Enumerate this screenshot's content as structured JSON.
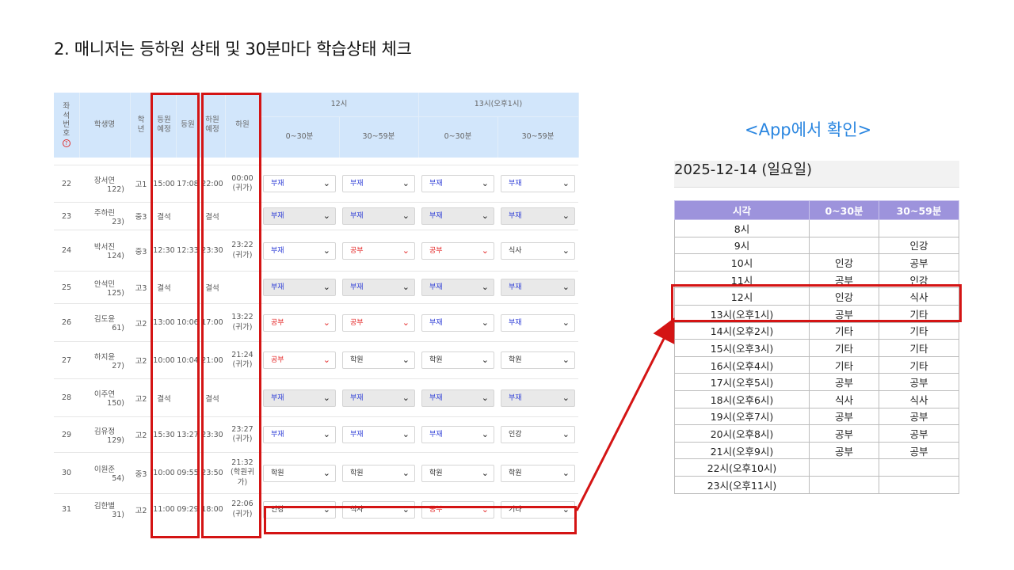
{
  "title": "2. 매니저는 등하원 상태 및 30분마다 학습상태 체크",
  "admin_table": {
    "headers": {
      "seat": "좌석번호",
      "name": "학생명",
      "grade": "학년",
      "arrive_planned": "등원예정",
      "arrive": "등원",
      "leave_planned": "하원예정",
      "leave": "하원",
      "hour12": "12시",
      "hour13": "13시(오후1시)",
      "slot1": "0~30분",
      "slot2": "30~59분"
    },
    "rows": [
      {
        "seat": "22",
        "name": "장서연",
        "sub": "122)",
        "grade": "고1",
        "arrive_planned": "15:00",
        "arrive": "17:08",
        "leave_planned": "22:00",
        "leave": "00:00 (귀가)",
        "s": [
          "부재",
          "부재",
          "부재",
          "부재"
        ]
      },
      {
        "seat": "23",
        "name": "주하린",
        "sub": "23)",
        "grade": "중3",
        "arrive_planned": "결석",
        "arrive": "",
        "leave_planned": "결석",
        "leave": "",
        "s": [
          "부재",
          "부재",
          "부재",
          "부재"
        ]
      },
      {
        "seat": "24",
        "name": "박서진",
        "sub": "124)",
        "grade": "중3",
        "arrive_planned": "12:30",
        "arrive": "12:33",
        "leave_planned": "23:30",
        "leave": "23:22 (귀가)",
        "s": [
          "부재",
          "공부",
          "공부",
          "식사"
        ]
      },
      {
        "seat": "25",
        "name": "안석민",
        "sub": "125)",
        "grade": "고3",
        "arrive_planned": "결석",
        "arrive": "",
        "leave_planned": "결석",
        "leave": "",
        "s": [
          "부재",
          "부재",
          "부재",
          "부재"
        ]
      },
      {
        "seat": "26",
        "name": "김도윤",
        "sub": "61)",
        "grade": "고2",
        "arrive_planned": "13:00",
        "arrive": "10:06",
        "leave_planned": "17:00",
        "leave": "13:22 (귀가)",
        "s": [
          "공부",
          "공부",
          "부재",
          "부재"
        ]
      },
      {
        "seat": "27",
        "name": "하지윤",
        "sub": "27)",
        "grade": "고2",
        "arrive_planned": "10:00",
        "arrive": "10:04",
        "leave_planned": "21:00",
        "leave": "21:24 (귀가)",
        "s": [
          "공부",
          "학원",
          "학원",
          "학원"
        ]
      },
      {
        "seat": "28",
        "name": "이주연",
        "sub": "150)",
        "grade": "고2",
        "arrive_planned": "결석",
        "arrive": "",
        "leave_planned": "결석",
        "leave": "",
        "s": [
          "부재",
          "부재",
          "부재",
          "부재"
        ]
      },
      {
        "seat": "29",
        "name": "김유정",
        "sub": "129)",
        "grade": "고2",
        "arrive_planned": "15:30",
        "arrive": "13:27",
        "leave_planned": "23:30",
        "leave": "23:27 (귀가)",
        "s": [
          "부재",
          "부재",
          "부재",
          "인강"
        ]
      },
      {
        "seat": "30",
        "name": "이원준",
        "sub": "54)",
        "grade": "중3",
        "arrive_planned": "10:00",
        "arrive": "09:55",
        "leave_planned": "23:50",
        "leave": "21:32 (학원귀가)",
        "s": [
          "학원",
          "학원",
          "학원",
          "학원"
        ]
      },
      {
        "seat": "31",
        "name": "김한별",
        "sub": "31)",
        "grade": "고2",
        "arrive_planned": "11:00",
        "arrive": "09:29",
        "leave_planned": "18:00",
        "leave": "22:06 (귀가)",
        "s": [
          "인강",
          "식사",
          "공부",
          "기타"
        ]
      }
    ]
  },
  "app_view": {
    "caption": "<App에서 확인>",
    "date": "2025-12-14 (일요일)",
    "headers": [
      "시각",
      "0~30분",
      "30~59분"
    ],
    "rows": [
      [
        "8시",
        "",
        ""
      ],
      [
        "9시",
        "",
        "인강"
      ],
      [
        "10시",
        "인강",
        "공부"
      ],
      [
        "11시",
        "공부",
        "인강"
      ],
      [
        "12시",
        "인강",
        "식사"
      ],
      [
        "13시(오후1시)",
        "공부",
        "기타"
      ],
      [
        "14시(오후2시)",
        "기타",
        "기타"
      ],
      [
        "15시(오후3시)",
        "기타",
        "기타"
      ],
      [
        "16시(오후4시)",
        "기타",
        "기타"
      ],
      [
        "17시(오후5시)",
        "공부",
        "공부"
      ],
      [
        "18시(오후6시)",
        "식사",
        "식사"
      ],
      [
        "19시(오후7시)",
        "공부",
        "공부"
      ],
      [
        "20시(오후8시)",
        "공부",
        "공부"
      ],
      [
        "21시(오후9시)",
        "공부",
        "공부"
      ],
      [
        "22시(오후10시)",
        "",
        ""
      ],
      [
        "23시(오후11시)",
        "",
        ""
      ]
    ]
  },
  "status_colors": {
    "부재": "#2b3bd6",
    "공부": "#e52b2b",
    "default": "#333333"
  },
  "highlight_color": "#d41414",
  "header_bg": "#d2e6fb",
  "app_header_bg": "#9d93dc"
}
